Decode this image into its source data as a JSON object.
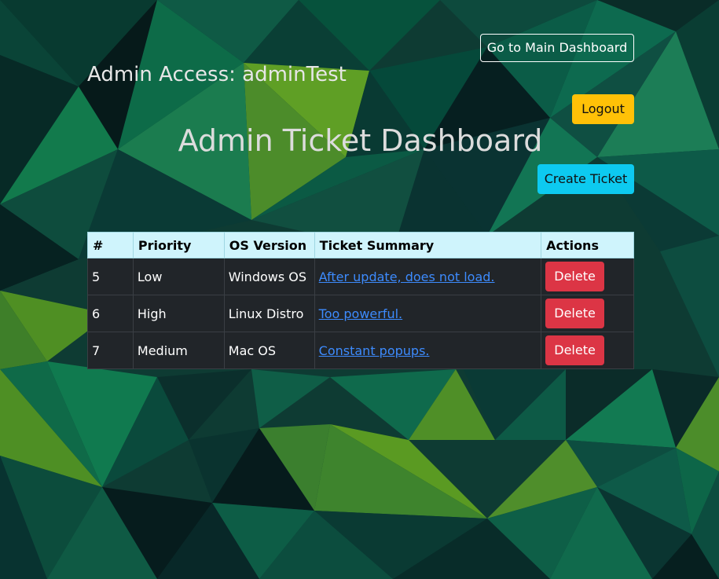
{
  "header": {
    "admin_access": "Admin Access: adminTest",
    "main_dashboard_label": "Go to Main Dashboard",
    "logout_label": "Logout",
    "title": "Admin Ticket Dashboard",
    "create_ticket_label": "Create Ticket"
  },
  "table": {
    "columns": [
      "#",
      "Priority",
      "OS Version",
      "Ticket Summary",
      "Actions"
    ],
    "rows": [
      {
        "num": "5",
        "priority": "Low",
        "os": "Windows OS",
        "summary": "After update, does not load.",
        "action": "Delete"
      },
      {
        "num": "6",
        "priority": "High",
        "os": "Linux Distro",
        "summary": "Too powerful.",
        "action": "Delete"
      },
      {
        "num": "7",
        "priority": "Medium",
        "os": "Mac OS",
        "summary": "Constant popups.",
        "action": "Delete"
      }
    ]
  },
  "colors": {
    "logout": "#ffc107",
    "create": "#0dcaf0",
    "delete": "#dc3545",
    "table_header": "#cff4fc",
    "table_body": "#212529",
    "link": "#3d8bfd"
  }
}
